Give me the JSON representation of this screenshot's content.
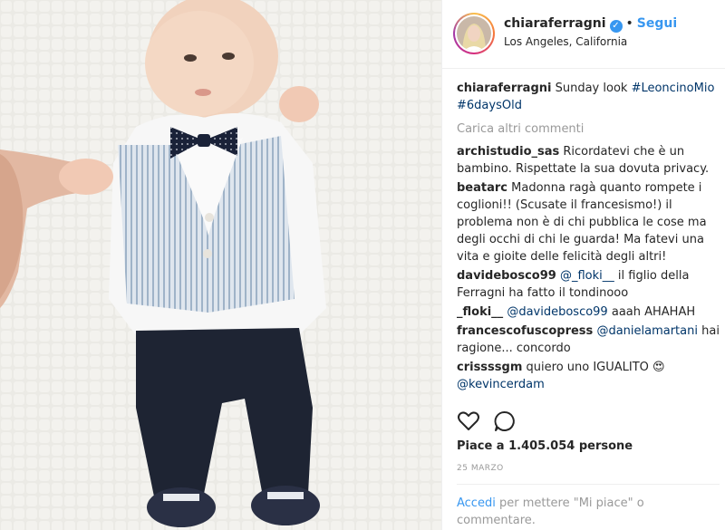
{
  "post": {
    "author": "chiaraferragni",
    "location": "Los Angeles, California",
    "follow_label": "Segui",
    "bullet": "•",
    "verified_icon": "verified-badge-icon"
  },
  "comments": [
    {
      "user": "chiaraferragni",
      "parts": [
        {
          "t": "text",
          "v": "Sunday look "
        },
        {
          "t": "tag",
          "v": "#LeoncinoMio"
        },
        {
          "t": "text",
          "v": " "
        },
        {
          "t": "tag",
          "v": "#6daysOld"
        }
      ]
    },
    {
      "load_more": "Carica altri commenti"
    },
    {
      "user": "archistudio_sas",
      "parts": [
        {
          "t": "text",
          "v": "Ricordatevi che è un bambino. Rispettate la sua dovuta privacy."
        }
      ]
    },
    {
      "user": "beatarc",
      "parts": [
        {
          "t": "text",
          "v": "Madonna ragà quanto rompete i coglioni!! (Scusate il francesismo!) il problema non è di chi pubblica le cose ma degli occhi di chi le guarda! Ma fatevi una vita e gioite delle felicità degli altri!"
        }
      ]
    },
    {
      "user": "davidebosco99",
      "parts": [
        {
          "t": "mention",
          "v": "@_floki__"
        },
        {
          "t": "text",
          "v": " il figlio della Ferragni ha fatto il tondinooo"
        }
      ]
    },
    {
      "user": "_floki__",
      "parts": [
        {
          "t": "mention",
          "v": "@davidebosco99"
        },
        {
          "t": "text",
          "v": " aaah AHAHAH"
        }
      ]
    },
    {
      "user": "francescofuscopress",
      "parts": [
        {
          "t": "mention",
          "v": "@danielamartani"
        },
        {
          "t": "text",
          "v": " hai ragione... concordo"
        }
      ]
    },
    {
      "user": "crissssgm",
      "parts": [
        {
          "t": "text",
          "v": "quiero uno IGUALITO 😍 "
        },
        {
          "t": "mention",
          "v": "@kevincerdam"
        }
      ]
    }
  ],
  "actions": {
    "like_icon": "heart-icon",
    "comment_icon": "comment-bubble-icon"
  },
  "likes_text": "Piace a 1.405.054 persone",
  "date": "25 MARZO",
  "login_prompt": {
    "link": "Accedi",
    "text": " per mettere \"Mi piace\" o commentare."
  },
  "colors": {
    "link_blue": "#3897f0",
    "hashtag_blue": "#003569",
    "muted": "#999999",
    "text": "#262626"
  }
}
